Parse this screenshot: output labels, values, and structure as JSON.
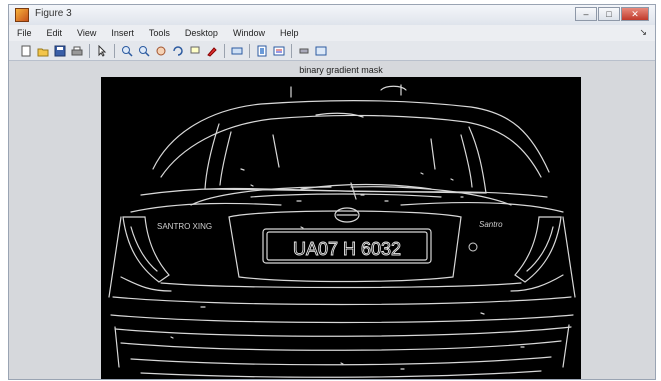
{
  "window": {
    "title": "Figure 3",
    "controls": {
      "minimize": "–",
      "maximize": "□",
      "close": "✕"
    }
  },
  "menu": {
    "items": [
      "File",
      "Edit",
      "View",
      "Insert",
      "Tools",
      "Desktop",
      "Window",
      "Help"
    ],
    "overflow_arrow": "↘"
  },
  "toolbar": {
    "icons": [
      "new-figure-icon",
      "open-file-icon",
      "save-icon",
      "print-icon",
      "pointer-icon",
      "zoom-in-icon",
      "zoom-out-icon",
      "pan-icon",
      "rotate-3d-icon",
      "data-cursor-icon",
      "brush-icon",
      "link-plot-icon",
      "colorbar-icon",
      "legend-icon",
      "hide-plot-tools-icon",
      "show-plot-tools-icon"
    ]
  },
  "figure": {
    "title": "binary gradient mask",
    "plate_text": "UA07 H 6032",
    "badge_left": "SANTRO XING",
    "badge_right": "Santro"
  }
}
